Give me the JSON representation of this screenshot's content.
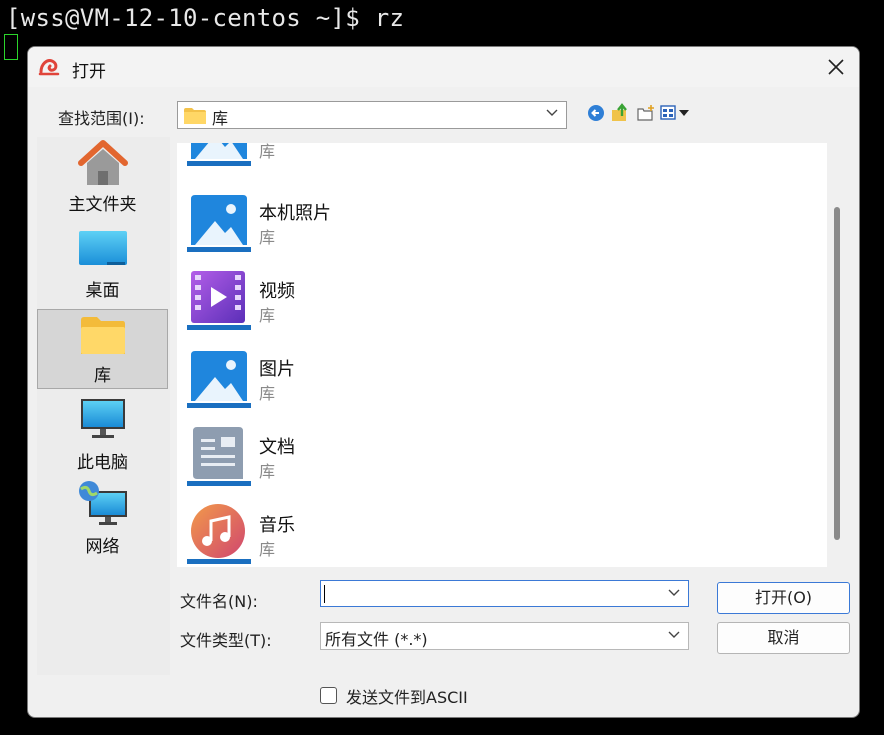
{
  "terminal": {
    "prompt": "[wss@VM-12-10-centos ~]$ rz"
  },
  "dialog": {
    "title": "打开",
    "look_in": {
      "label": "查找范围(I):",
      "value": "库"
    },
    "sidebar": [
      {
        "label": "主文件夹",
        "icon": "home-icon"
      },
      {
        "label": "桌面",
        "icon": "desktop-icon"
      },
      {
        "label": "库",
        "icon": "library-folder-icon",
        "selected": true
      },
      {
        "label": "此电脑",
        "icon": "computer-icon"
      },
      {
        "label": "网络",
        "icon": "network-icon"
      }
    ],
    "files": [
      {
        "name": "",
        "type": "库",
        "icon": "pictures-library-icon"
      },
      {
        "name": "本机照片",
        "type": "库",
        "icon": "pictures-library-icon"
      },
      {
        "name": "视频",
        "type": "库",
        "icon": "video-library-icon"
      },
      {
        "name": "图片",
        "type": "库",
        "icon": "pictures-library-icon"
      },
      {
        "name": "文档",
        "type": "库",
        "icon": "documents-library-icon"
      },
      {
        "name": "音乐",
        "type": "库",
        "icon": "music-library-icon"
      }
    ],
    "filename": {
      "label": "文件名(N):",
      "value": ""
    },
    "filetype": {
      "label": "文件类型(T):",
      "value": "所有文件 (*.*)"
    },
    "buttons": {
      "open": "打开(O)",
      "cancel": "取消"
    },
    "ascii_option": {
      "label": "发送文件到ASCII",
      "checked": false
    },
    "colors": {
      "accent": "#3b79d6",
      "selected_bg": "#d6d6d6"
    }
  }
}
